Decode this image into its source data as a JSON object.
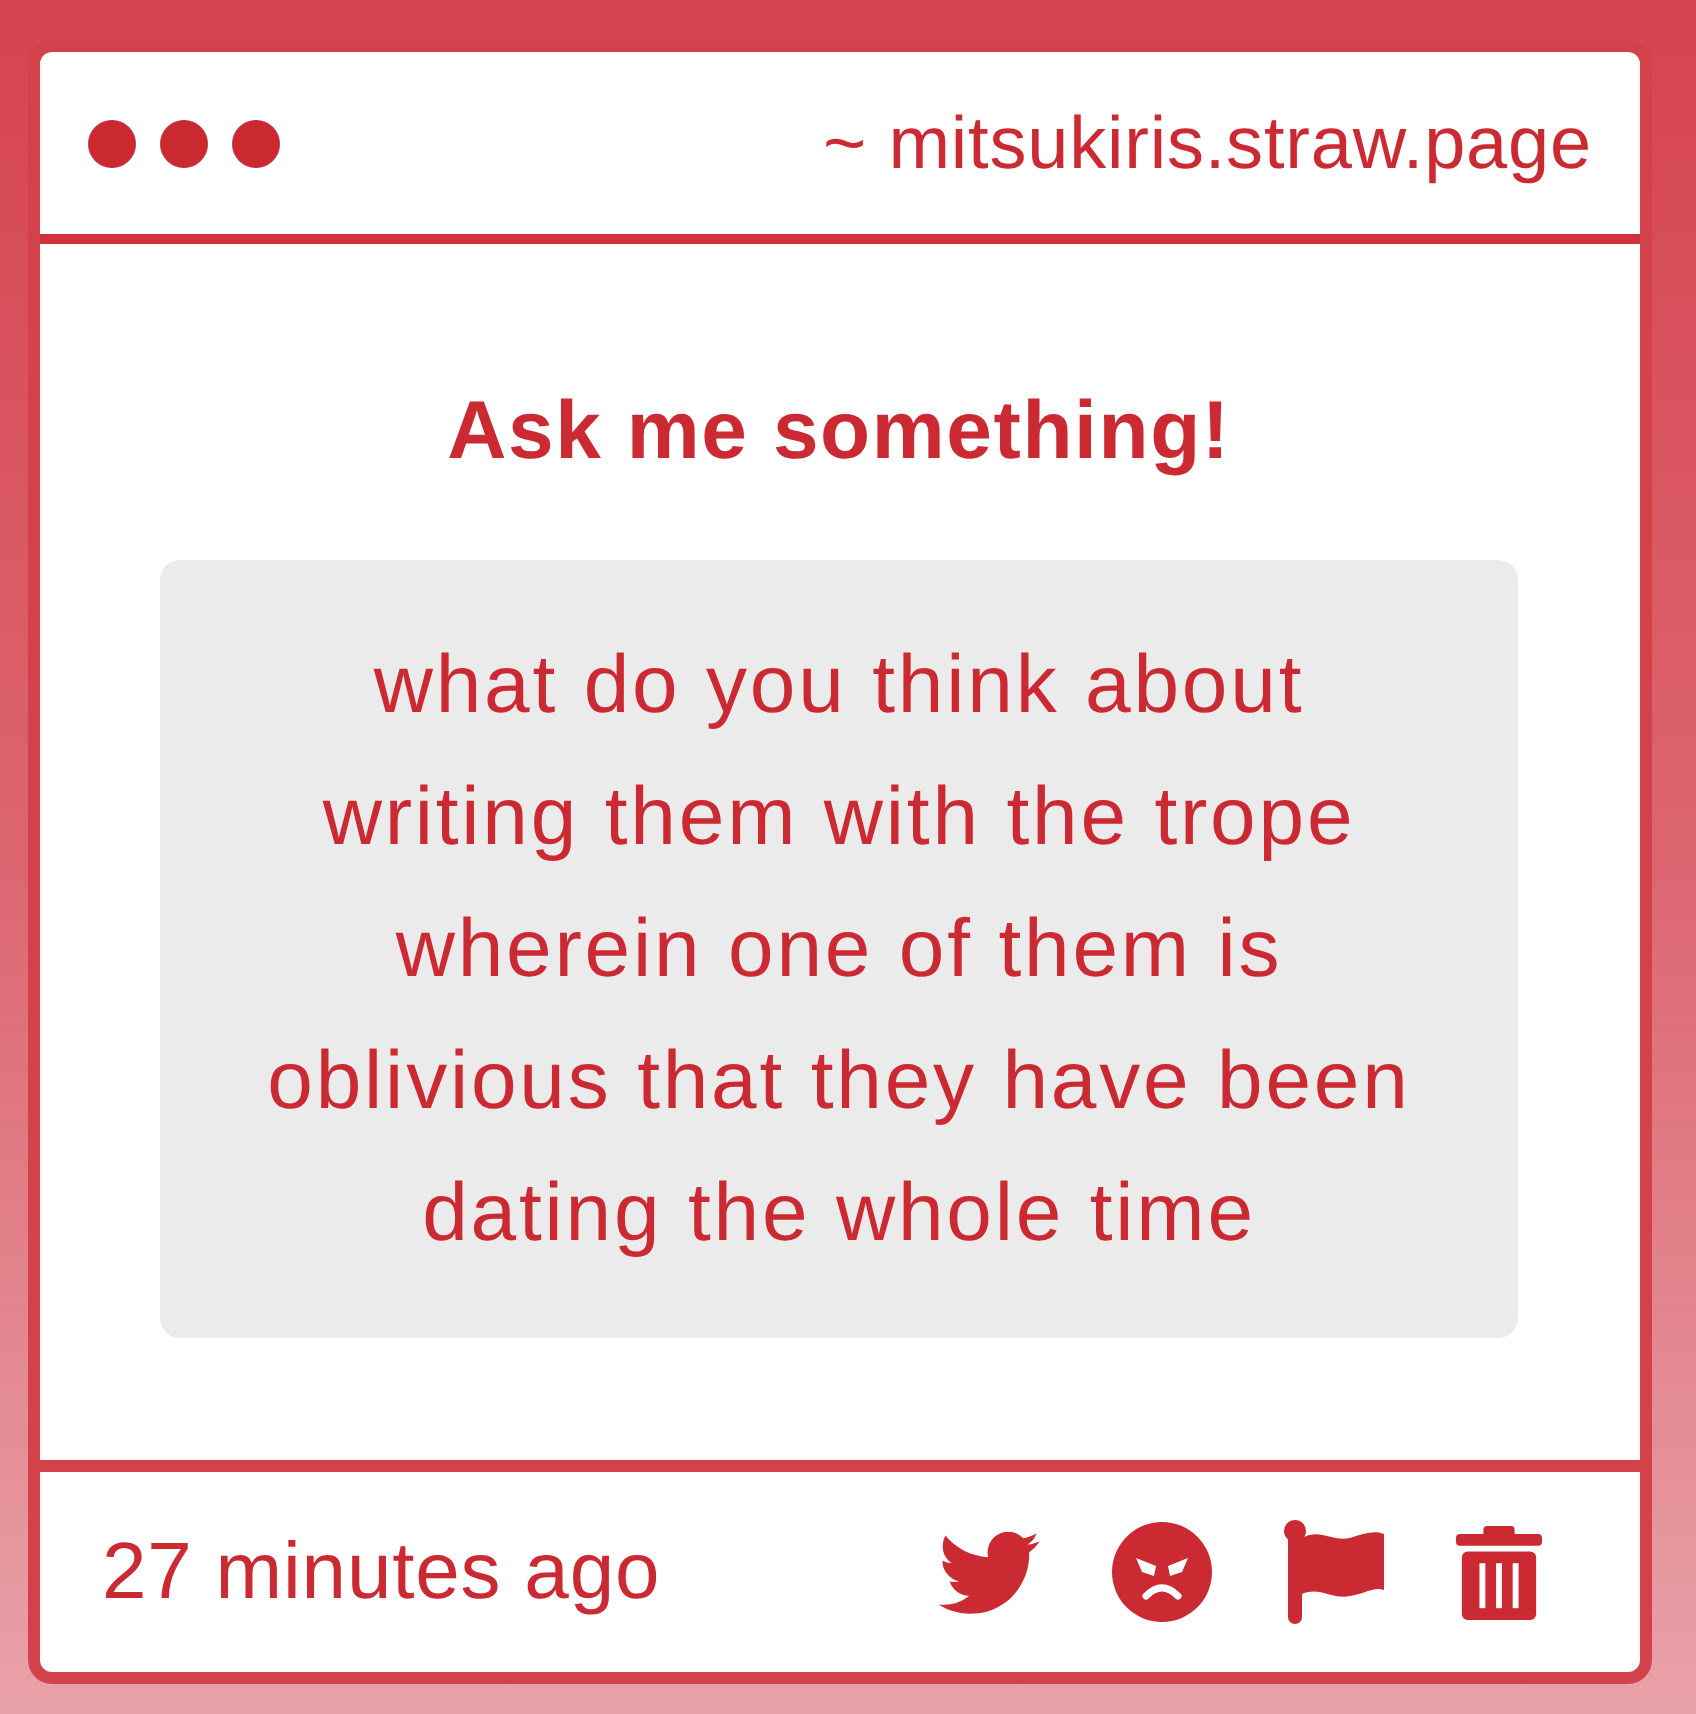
{
  "header": {
    "address": "~ mitsukiris.straw.page"
  },
  "card": {
    "title": "Ask me something!",
    "question": "what do you think about writing them with the trope wherein one of them is oblivious that they have been dating the whole time"
  },
  "footer": {
    "time": "27 minutes ago"
  }
}
